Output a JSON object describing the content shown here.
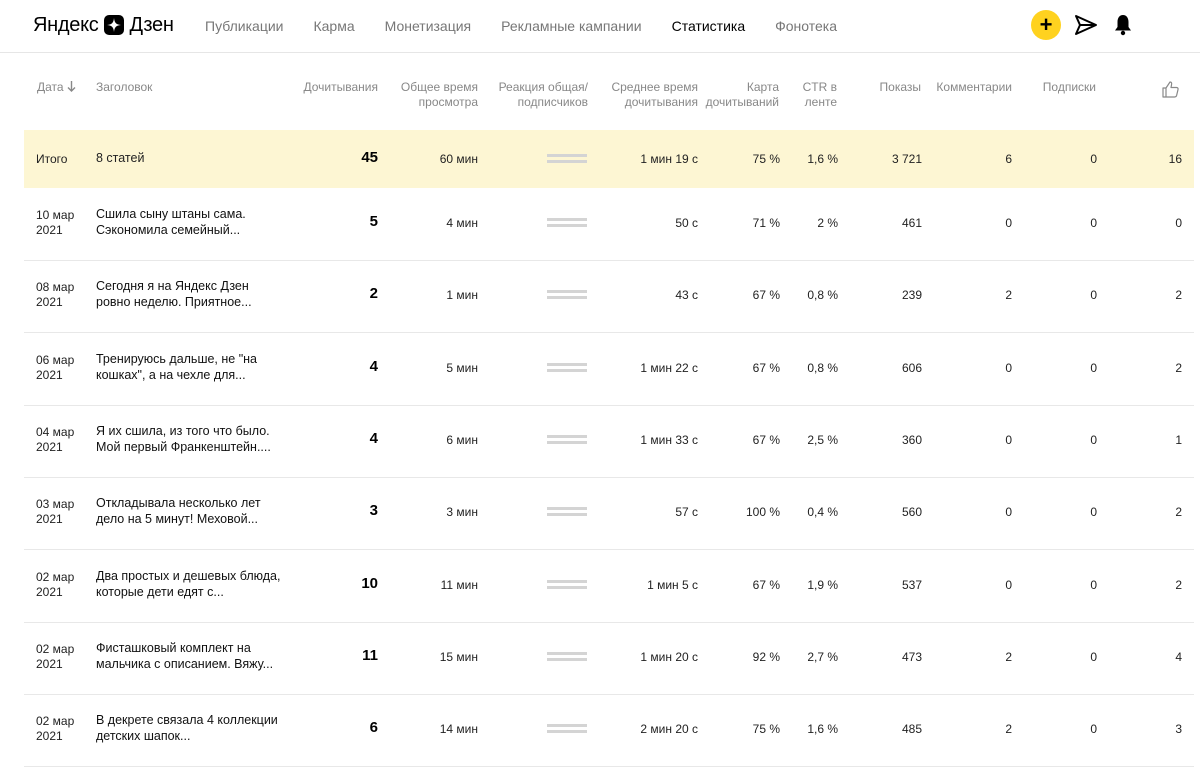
{
  "header": {
    "logo_text": "Яндекс",
    "logo_text2": "Дзен",
    "nav": [
      {
        "label": "Публикации",
        "active": false
      },
      {
        "label": "Карма",
        "active": false
      },
      {
        "label": "Монетизация",
        "active": false
      },
      {
        "label": "Рекламные кампании",
        "active": false
      },
      {
        "label": "Статистика",
        "active": true
      },
      {
        "label": "Фонотека",
        "active": false
      }
    ],
    "plus_label": "+",
    "icons": [
      "plus-icon",
      "send-icon",
      "bell-icon"
    ],
    "accent_color": "#ffd21f"
  },
  "table": {
    "columns": {
      "date": "Дата",
      "title": "Заголовок",
      "reads": "Дочитывания",
      "total_time": "Общее время просмотра",
      "reaction": "Реакция общая/ подписчиков",
      "avg_time": "Среднее время дочитывания",
      "map": "Карта дочитываний",
      "ctr": "CTR в ленте",
      "shows": "Показы",
      "comments": "Комментарии",
      "subs": "Подписки",
      "likes_icon": "thumbs-up-icon"
    },
    "total": {
      "date": "Итого",
      "title": "8 статей",
      "reads": "45",
      "total_time": "60 мин",
      "avg_time": "1 мин 19 с",
      "map": "75 %",
      "ctr": "1,6 %",
      "shows": "3 721",
      "comments": "6",
      "subs": "0",
      "likes": "16"
    },
    "rows": [
      {
        "date1": "10 мар",
        "date2": "2021",
        "title1": "Сшила сыну штаны сама.",
        "title2": "Сэкономила семейный...",
        "reads": "5",
        "total_time": "4 мин",
        "avg_time": "50 с",
        "map": "71 %",
        "ctr": "2 %",
        "shows": "461",
        "comments": "0",
        "subs": "0",
        "likes": "0"
      },
      {
        "date1": "08 мар",
        "date2": "2021",
        "title1": "Сегодня я на Яндекс Дзен",
        "title2": "ровно неделю. Приятное...",
        "reads": "2",
        "total_time": "1 мин",
        "avg_time": "43 с",
        "map": "67 %",
        "ctr": "0,8 %",
        "shows": "239",
        "comments": "2",
        "subs": "0",
        "likes": "2"
      },
      {
        "date1": "06 мар",
        "date2": "2021",
        "title1": "Тренируюсь дальше, не \"на",
        "title2": "кошках\", а на чехле для...",
        "reads": "4",
        "total_time": "5 мин",
        "avg_time": "1 мин 22 с",
        "map": "67 %",
        "ctr": "0,8 %",
        "shows": "606",
        "comments": "0",
        "subs": "0",
        "likes": "2"
      },
      {
        "date1": "04 мар",
        "date2": "2021",
        "title1": "Я их сшила, из того что было.",
        "title2": "Мой первый Франкенштейн....",
        "reads": "4",
        "total_time": "6 мин",
        "avg_time": "1 мин 33 с",
        "map": "67 %",
        "ctr": "2,5 %",
        "shows": "360",
        "comments": "0",
        "subs": "0",
        "likes": "1"
      },
      {
        "date1": "03 мар",
        "date2": "2021",
        "title1": "Откладывала несколько лет",
        "title2": "дело на 5 минут! Меховой...",
        "reads": "3",
        "total_time": "3 мин",
        "avg_time": "57 с",
        "map": "100 %",
        "ctr": "0,4 %",
        "shows": "560",
        "comments": "0",
        "subs": "0",
        "likes": "2"
      },
      {
        "date1": "02 мар",
        "date2": "2021",
        "title1": "Два простых и дешевых блюда,",
        "title2": "которые дети едят с...",
        "reads": "10",
        "total_time": "11 мин",
        "avg_time": "1 мин 5 с",
        "map": "67 %",
        "ctr": "1,9 %",
        "shows": "537",
        "comments": "0",
        "subs": "0",
        "likes": "2"
      },
      {
        "date1": "02 мар",
        "date2": "2021",
        "title1": "Фисташковый комплект на",
        "title2": "мальчика с описанием. Вяжу...",
        "reads": "11",
        "total_time": "15 мин",
        "avg_time": "1 мин 20 с",
        "map": "92 %",
        "ctr": "2,7 %",
        "shows": "473",
        "comments": "2",
        "subs": "0",
        "likes": "4"
      },
      {
        "date1": "02 мар",
        "date2": "2021",
        "title1": "В декрете связала 4 коллекции",
        "title2": "детских шапок...",
        "reads": "6",
        "total_time": "14 мин",
        "avg_time": "2 мин 20 с",
        "map": "75 %",
        "ctr": "1,6 %",
        "shows": "485",
        "comments": "2",
        "subs": "0",
        "likes": "3"
      }
    ]
  }
}
